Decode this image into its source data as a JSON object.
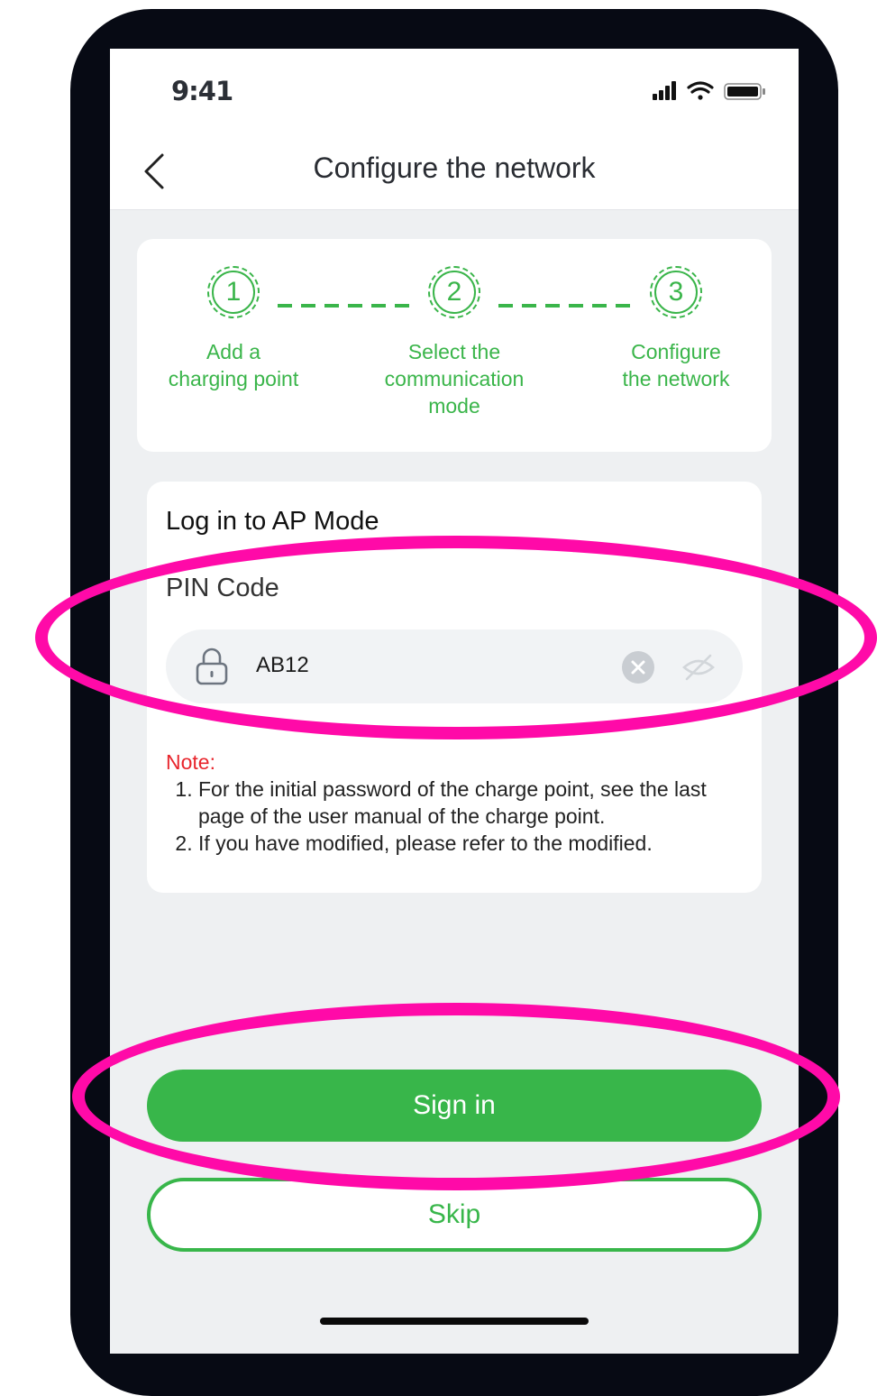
{
  "status_bar": {
    "time": "9:41",
    "icons": [
      "signal-icon",
      "wifi-icon",
      "battery-icon"
    ]
  },
  "header": {
    "back_icon": "chevron-left-icon",
    "title": "Configure the network"
  },
  "steps": [
    {
      "number": "1",
      "label_lines": [
        "Add a",
        "charging point"
      ]
    },
    {
      "number": "2",
      "label_lines": [
        "Select the",
        "communication",
        "mode"
      ]
    },
    {
      "number": "3",
      "label_lines": [
        "Configure",
        "the network"
      ]
    }
  ],
  "login": {
    "title": "Log in to AP Mode",
    "pin_label": "PIN Code",
    "pin_value": "AB12",
    "lock_icon": "lock-icon",
    "clear_icon": "clear-icon",
    "visibility_icon": "eye-off-icon"
  },
  "note": {
    "title": "Note:",
    "items": [
      "For the initial password of the charge point, see the last page of the user manual of the charge point.",
      "If you have modified, please refer to the modified."
    ]
  },
  "buttons": {
    "sign_in": "Sign in",
    "skip": "Skip"
  },
  "colors": {
    "accent": "#38b64a",
    "note_title": "#e8262d",
    "annotation": "#ff0aa8"
  }
}
